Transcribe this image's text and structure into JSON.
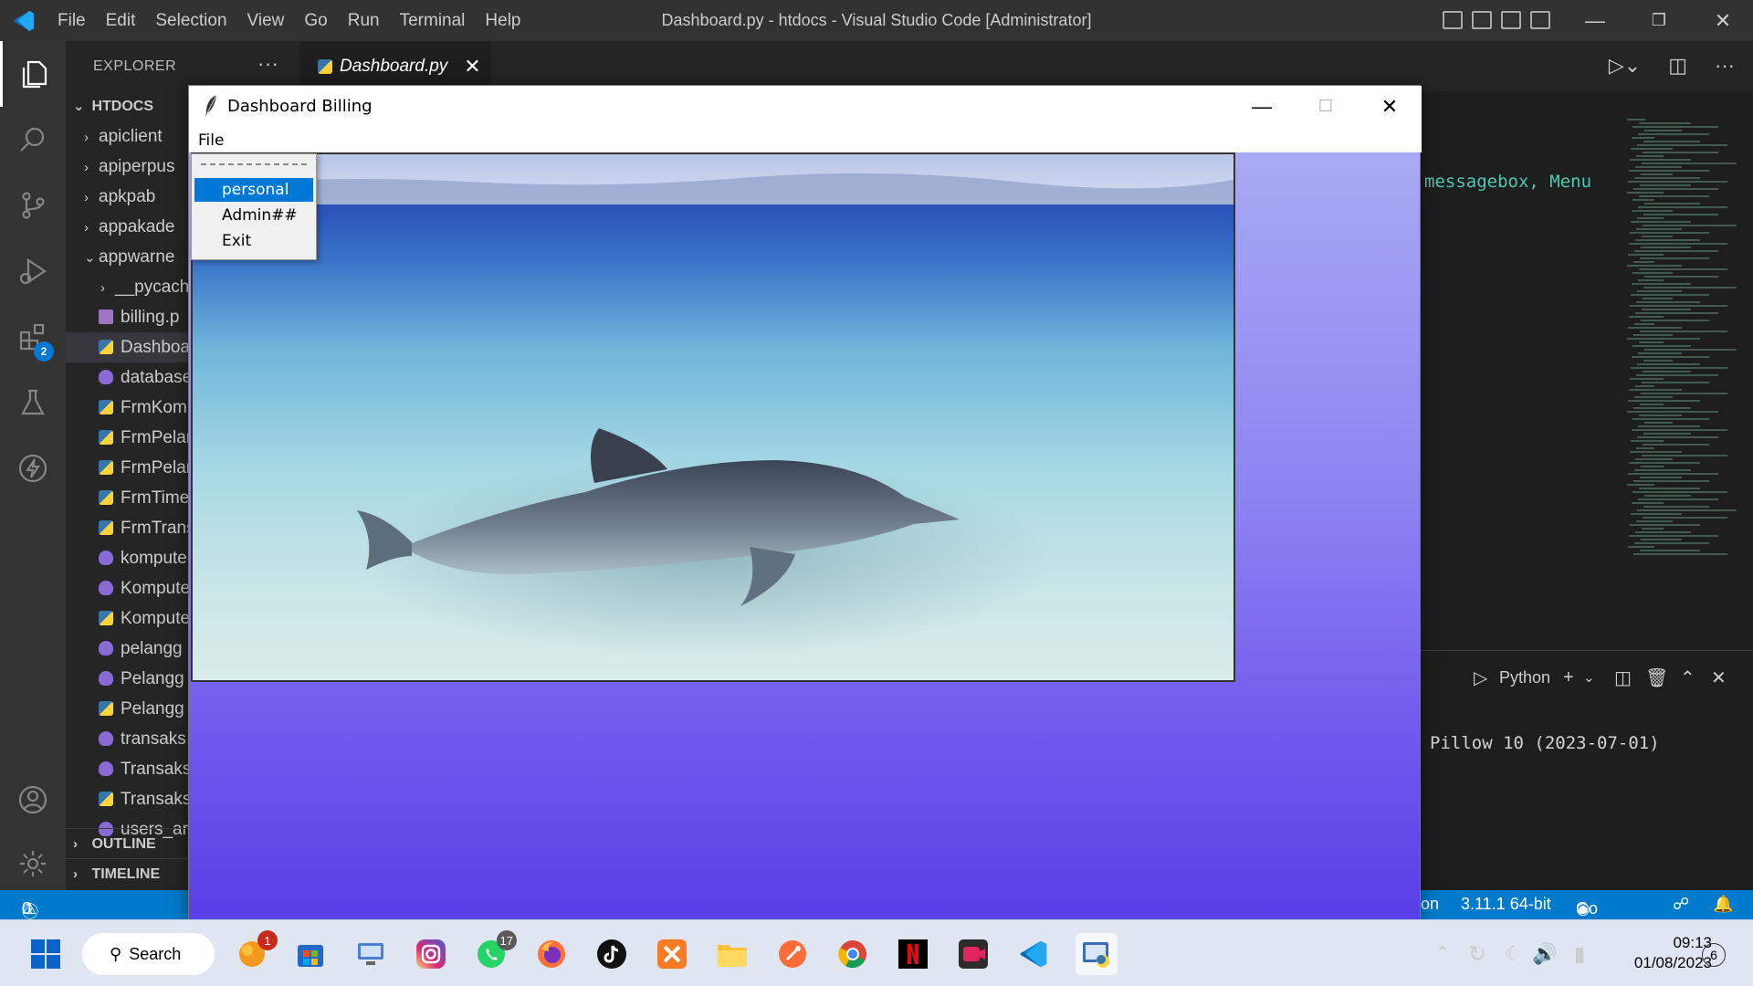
{
  "window_title": "Dashboard.py - htdocs - Visual Studio Code [Administrator]",
  "menubar": [
    "File",
    "Edit",
    "Selection",
    "View",
    "Go",
    "Run",
    "Terminal",
    "Help"
  ],
  "activity": {
    "extensions_badge": "2"
  },
  "explorer": {
    "header": "EXPLORER",
    "more": "···",
    "root": "HTDOCS",
    "items": [
      {
        "label": "apiclient",
        "kind": "folder"
      },
      {
        "label": "apiperpus",
        "kind": "folder"
      },
      {
        "label": "apkpab",
        "kind": "folder"
      },
      {
        "label": "appakade",
        "kind": "folder"
      },
      {
        "label": "appwarne",
        "kind": "folder-open"
      },
      {
        "label": "__pycach",
        "kind": "subfolder"
      },
      {
        "label": "billing.p",
        "kind": "img"
      },
      {
        "label": "Dashboa",
        "kind": "py",
        "selected": true
      },
      {
        "label": "database",
        "kind": "php"
      },
      {
        "label": "FrmKom",
        "kind": "py"
      },
      {
        "label": "FrmPelar",
        "kind": "py"
      },
      {
        "label": "FrmPelar",
        "kind": "py"
      },
      {
        "label": "FrmTime",
        "kind": "py"
      },
      {
        "label": "FrmTrans",
        "kind": "py"
      },
      {
        "label": "kompute",
        "kind": "php"
      },
      {
        "label": "Kompute",
        "kind": "php"
      },
      {
        "label": "Kompute",
        "kind": "py"
      },
      {
        "label": "pelangg",
        "kind": "php"
      },
      {
        "label": "Pelangg",
        "kind": "php"
      },
      {
        "label": "Pelangg",
        "kind": "py"
      },
      {
        "label": "transaks",
        "kind": "php"
      },
      {
        "label": "Transaks",
        "kind": "php"
      },
      {
        "label": "Transaks",
        "kind": "py"
      },
      {
        "label": "users_ar",
        "kind": "php"
      }
    ],
    "outline": "OUTLINE",
    "timeline": "TIMELINE"
  },
  "editor": {
    "tab_label": "Dashboard.py",
    "code_visible_1": "messagebox,",
    "code_visible_2": "Menu"
  },
  "panel": {
    "terminal_name": "Python",
    "output_line": "Pillow 10 (2023-07-01)"
  },
  "statusbar": {
    "errors": "0",
    "warnings": "0",
    "lang_fragment": "on",
    "python_version": "3.11.1 64-bit",
    "go_live": "Go Live"
  },
  "tk_window": {
    "title": "Dashboard Billing",
    "menu_file": "File",
    "dropdown": {
      "items": [
        "personal",
        "Admin##",
        "Exit"
      ],
      "highlighted": 0
    }
  },
  "taskbar": {
    "search_label": "Search",
    "badge_1": "1",
    "badge_whatsapp": "17",
    "time": "09:13",
    "date": "01/08/2023",
    "notification_count": "6"
  }
}
